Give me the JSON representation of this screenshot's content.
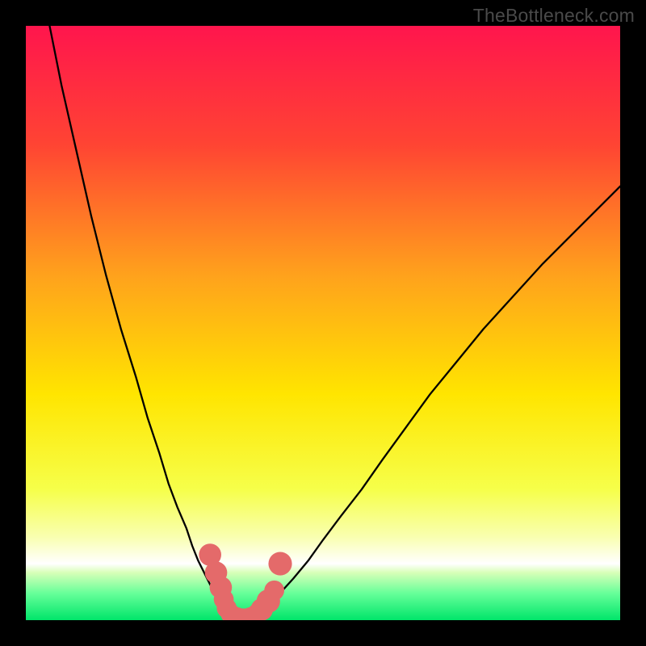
{
  "watermark": "TheBottleneck.com",
  "chart_data": {
    "type": "line",
    "title": "",
    "xlabel": "",
    "ylabel": "",
    "xlim": [
      0,
      100
    ],
    "ylim": [
      0,
      100
    ],
    "background_gradient": {
      "stops": [
        {
          "offset": 0.0,
          "color": "#ff154d"
        },
        {
          "offset": 0.2,
          "color": "#ff4433"
        },
        {
          "offset": 0.42,
          "color": "#ffa21c"
        },
        {
          "offset": 0.62,
          "color": "#ffe500"
        },
        {
          "offset": 0.78,
          "color": "#f6ff4a"
        },
        {
          "offset": 0.86,
          "color": "#f9ffb0"
        },
        {
          "offset": 0.905,
          "color": "#ffffff"
        },
        {
          "offset": 0.92,
          "color": "#d8ffb8"
        },
        {
          "offset": 0.955,
          "color": "#66ff99"
        },
        {
          "offset": 1.0,
          "color": "#00e56a"
        }
      ]
    },
    "series": [
      {
        "name": "left-curve",
        "x": [
          4.0,
          6.0,
          8.5,
          11.0,
          13.5,
          16.0,
          18.5,
          20.5,
          22.5,
          24.0,
          25.5,
          27.0,
          28.0,
          29.0,
          30.0,
          30.8,
          31.5,
          32.2,
          32.9,
          33.5
        ],
        "y": [
          100.0,
          90.0,
          79.0,
          68.0,
          58.0,
          49.0,
          41.0,
          34.0,
          28.0,
          23.0,
          19.0,
          15.5,
          12.5,
          10.0,
          8.0,
          6.4,
          5.0,
          3.8,
          2.8,
          2.0
        ]
      },
      {
        "name": "right-curve",
        "x": [
          40.0,
          41.5,
          43.0,
          45.0,
          47.5,
          50.0,
          53.0,
          56.5,
          60.0,
          64.0,
          68.0,
          72.5,
          77.0,
          82.0,
          87.0,
          92.0,
          97.0,
          100.0
        ],
        "y": [
          2.0,
          3.2,
          4.8,
          7.0,
          10.0,
          13.5,
          17.5,
          22.0,
          27.0,
          32.5,
          38.0,
          43.5,
          49.0,
          54.5,
          60.0,
          65.0,
          70.0,
          73.0
        ]
      },
      {
        "name": "bottom-arc",
        "x": [
          33.5,
          34.2,
          35.0,
          36.0,
          37.0,
          38.0,
          39.0,
          40.0
        ],
        "y": [
          2.0,
          1.2,
          0.6,
          0.2,
          0.2,
          0.6,
          1.2,
          2.0
        ]
      }
    ],
    "markers": [
      {
        "x": 31.0,
        "y": 11.0,
        "r": 1.2
      },
      {
        "x": 32.0,
        "y": 8.0,
        "r": 1.2
      },
      {
        "x": 32.8,
        "y": 5.5,
        "r": 1.2
      },
      {
        "x": 33.3,
        "y": 3.5,
        "r": 1.0
      },
      {
        "x": 33.8,
        "y": 2.0,
        "r": 1.0
      },
      {
        "x": 34.5,
        "y": 1.0,
        "r": 1.0
      },
      {
        "x": 35.5,
        "y": 0.5,
        "r": 1.0
      },
      {
        "x": 36.6,
        "y": 0.3,
        "r": 1.0
      },
      {
        "x": 37.8,
        "y": 0.5,
        "r": 1.0
      },
      {
        "x": 38.8,
        "y": 1.0,
        "r": 1.0
      },
      {
        "x": 39.7,
        "y": 1.8,
        "r": 1.2
      },
      {
        "x": 40.8,
        "y": 3.2,
        "r": 1.3
      },
      {
        "x": 41.8,
        "y": 5.0,
        "r": 1.0
      },
      {
        "x": 42.8,
        "y": 9.5,
        "r": 1.3
      }
    ],
    "marker_color": "#e46a6a",
    "curve_color": "#000000",
    "curve_width": 2.3
  }
}
